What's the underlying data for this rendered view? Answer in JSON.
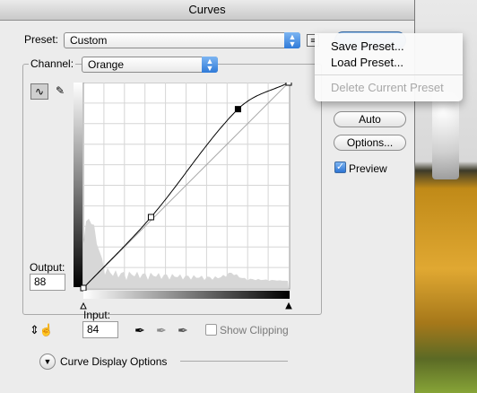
{
  "window": {
    "title": "Curves"
  },
  "preset": {
    "label": "Preset:",
    "value": "Custom"
  },
  "channel": {
    "label": "Channel:",
    "value": "Orange"
  },
  "preset_menu": {
    "items": [
      {
        "label": "Save Preset...",
        "enabled": true
      },
      {
        "label": "Load Preset...",
        "enabled": true
      },
      {
        "label": "Delete Current Preset",
        "enabled": false
      }
    ]
  },
  "buttons": {
    "auto": "Auto",
    "options": "Options..."
  },
  "preview": {
    "label": "Preview",
    "checked": true
  },
  "output": {
    "label": "Output:",
    "value": "88"
  },
  "input": {
    "label": "Input:",
    "value": "84"
  },
  "show_clipping": {
    "label": "Show Clipping",
    "checked": false
  },
  "curve_display": {
    "label": "Curve Display Options"
  },
  "curve": {
    "range": [
      0,
      255
    ],
    "points": [
      [
        0,
        0
      ],
      [
        84,
        88
      ],
      [
        192,
        222
      ],
      [
        255,
        255
      ]
    ],
    "selected": [
      84,
      88
    ]
  }
}
